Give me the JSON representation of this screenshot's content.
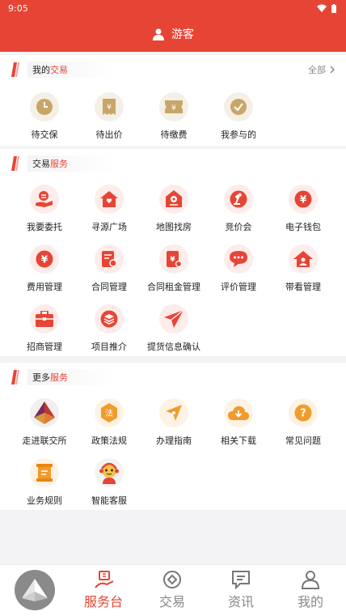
{
  "status": {
    "time": "9:05"
  },
  "header": {
    "user_label": "游客"
  },
  "section_trade": {
    "title_prefix": "我的",
    "title_highlight": "交易",
    "more_label": "全部",
    "items": [
      {
        "label": "待交保",
        "icon": "clock-icon"
      },
      {
        "label": "待出价",
        "icon": "bid-icon"
      },
      {
        "label": "待缴费",
        "icon": "ticket-icon"
      },
      {
        "label": "我参与的",
        "icon": "check-icon"
      }
    ]
  },
  "section_service": {
    "title_prefix": "交易",
    "title_highlight": "服务",
    "items": [
      {
        "label": "我要委托",
        "icon": "entrust-icon"
      },
      {
        "label": "寻源广场",
        "icon": "house-icon"
      },
      {
        "label": "地图找房",
        "icon": "map-house-icon"
      },
      {
        "label": "竞价会",
        "icon": "gavel-icon"
      },
      {
        "label": "电子钱包",
        "icon": "wallet-icon"
      },
      {
        "label": "费用管理",
        "icon": "yen-icon"
      },
      {
        "label": "合同管理",
        "icon": "contract-icon"
      },
      {
        "label": "合同租金管理",
        "icon": "rent-contract-icon"
      },
      {
        "label": "评价管理",
        "icon": "comment-icon"
      },
      {
        "label": "带看管理",
        "icon": "viewing-icon"
      },
      {
        "label": "招商管理",
        "icon": "briefcase-icon"
      },
      {
        "label": "项目推介",
        "icon": "layers-icon"
      },
      {
        "label": "提货信息确认",
        "icon": "send-icon"
      }
    ]
  },
  "section_more": {
    "title_prefix": "更多",
    "title_highlight": "服务",
    "items": [
      {
        "label": "走进联交所",
        "icon": "exchange-logo-icon"
      },
      {
        "label": "政策法规",
        "icon": "law-icon"
      },
      {
        "label": "办理指南",
        "icon": "compass-icon"
      },
      {
        "label": "相关下载",
        "icon": "cloud-download-icon"
      },
      {
        "label": "常见问题",
        "icon": "question-icon"
      },
      {
        "label": "业务规则",
        "icon": "rules-icon"
      },
      {
        "label": "智能客服",
        "icon": "robot-icon"
      }
    ]
  },
  "tabbar": {
    "tabs": [
      {
        "label": "服务台",
        "icon": "service-desk-icon",
        "active": true
      },
      {
        "label": "交易",
        "icon": "trade-icon",
        "active": false
      },
      {
        "label": "资讯",
        "icon": "news-icon",
        "active": false
      },
      {
        "label": "我的",
        "icon": "profile-icon",
        "active": false
      }
    ]
  },
  "colors": {
    "brand": "#e64535",
    "gold": "#c8a66a",
    "muted": "#888888"
  }
}
